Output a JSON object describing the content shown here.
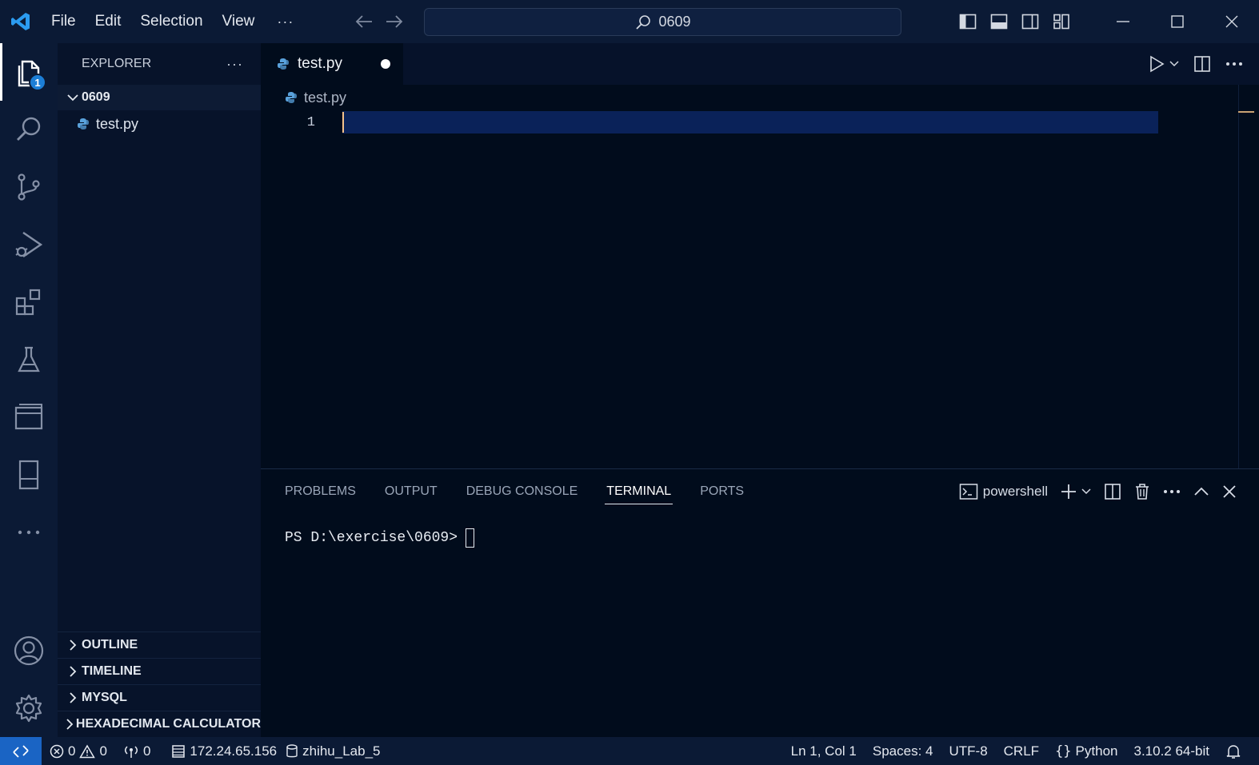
{
  "titlebar": {
    "menu": [
      "File",
      "Edit",
      "Selection",
      "View"
    ],
    "more": "···",
    "search_text": "0609"
  },
  "activity": {
    "explorer_badge": "1"
  },
  "sidebar": {
    "title": "EXPLORER",
    "more": "···",
    "folder": "0609",
    "files": [
      "test.py"
    ],
    "sections": [
      "OUTLINE",
      "TIMELINE",
      "MYSQL",
      "HEXADECIMAL CALCULATOR"
    ]
  },
  "editor": {
    "tab_label": "test.py",
    "breadcrumb": "test.py",
    "line_number": "1"
  },
  "panel": {
    "tabs": [
      "PROBLEMS",
      "OUTPUT",
      "DEBUG CONSOLE",
      "TERMINAL",
      "PORTS"
    ],
    "active_tab": "TERMINAL",
    "terminal_name": "powershell",
    "prompt": "PS D:\\exercise\\0609>"
  },
  "statusbar": {
    "errors": "0",
    "warnings": "0",
    "ports": "0",
    "ip": "172.24.65.156",
    "db": "zhihu_Lab_5",
    "cursor_pos": "Ln 1, Col 1",
    "spaces": "Spaces: 4",
    "encoding": "UTF-8",
    "eol": "CRLF",
    "language": "Python",
    "interpreter": "3.10.2 64-bit"
  },
  "colors": {
    "accent": "#1a64c4",
    "background": "#010c1c",
    "chrome": "#0b1a35",
    "current_line": "#0a2259",
    "cursor": "#f5c28b"
  }
}
